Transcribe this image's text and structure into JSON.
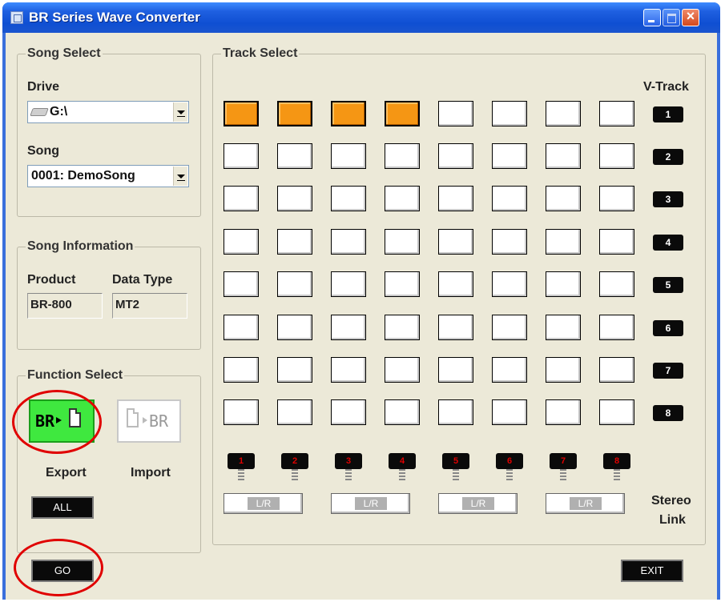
{
  "window": {
    "title": "BR Series Wave Converter"
  },
  "song_select": {
    "legend": "Song Select",
    "drive_label": "Drive",
    "drive_value": "G:\\",
    "song_label": "Song",
    "song_value": "0001: DemoSong"
  },
  "song_info": {
    "legend": "Song Information",
    "product_label": "Product",
    "product_value": "BR-800",
    "datatype_label": "Data Type",
    "datatype_value": "MT2"
  },
  "function_select": {
    "legend": "Function Select",
    "export_icon_text": "BR",
    "import_icon_text": "BR",
    "export_label": "Export",
    "import_label": "Import",
    "all_label": "ALL"
  },
  "track_select": {
    "legend": "Track Select",
    "vtrack_label": "V-Track",
    "vtrack_numbers": [
      "1",
      "2",
      "3",
      "4",
      "5",
      "6",
      "7",
      "8"
    ],
    "selected_row1": [
      true,
      true,
      true,
      true,
      false,
      false,
      false,
      false
    ],
    "channel_numbers": [
      "1",
      "2",
      "3",
      "4",
      "5",
      "6",
      "7",
      "8"
    ],
    "stereo_link_button_label": "L/R",
    "stereo_label_line1": "Stereo",
    "stereo_label_line2": "Link"
  },
  "footer": {
    "go_label": "GO",
    "exit_label": "EXIT"
  },
  "colors": {
    "selected_track": "#f59614",
    "export_active": "#3fe83f",
    "annotation_circle": "#e00000"
  }
}
